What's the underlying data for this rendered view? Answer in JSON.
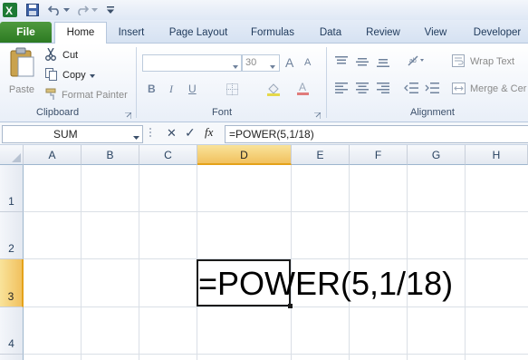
{
  "tabs": [
    "File",
    "Home",
    "Insert",
    "Page Layout",
    "Formulas",
    "Data",
    "Review",
    "View",
    "Developer"
  ],
  "clipboard": {
    "paste": "Paste",
    "cut": "Cut",
    "copy": "Copy",
    "format_painter": "Format Painter",
    "label": "Clipboard"
  },
  "font": {
    "size": "30",
    "bold": "B",
    "italic": "I",
    "underline": "U",
    "grow": "A",
    "shrink": "A",
    "label": "Font"
  },
  "alignment": {
    "wrap_text": "Wrap Text",
    "merge": "Merge & Cer",
    "label": "Alignment"
  },
  "formula_bar": {
    "name_box": "SUM",
    "cancel": "✕",
    "enter": "✓",
    "fx": "fx",
    "formula": "=POWER(5,1/18)"
  },
  "columns": [
    "A",
    "B",
    "C",
    "D",
    "E",
    "F",
    "G",
    "H"
  ],
  "rows": [
    "1",
    "2",
    "3",
    "4"
  ],
  "active_cell": {
    "ref": "D3",
    "text": "=POWER(5,1/18)"
  },
  "colors": {
    "file_tab": "#2c7a22",
    "selected_header": "#f1c15f",
    "ribbon_text": "#1e395b"
  }
}
